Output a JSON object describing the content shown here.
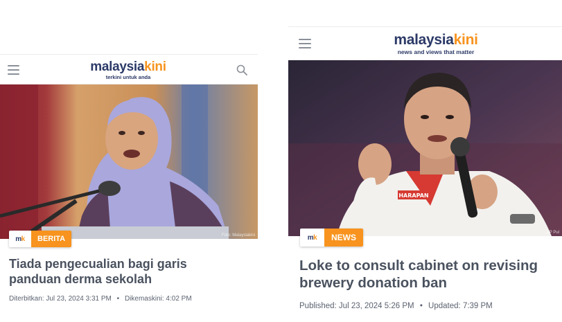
{
  "left_card": {
    "logo_part1": "malaysia",
    "logo_part2": "kini",
    "tagline": "terkini untuk anda",
    "photo_credit": "Foto: Malaysiakini",
    "badge_mark_1": "m",
    "badge_mark_2": "k",
    "category": "BERITA",
    "headline": "Tiada pengecualian bagi garis panduan derma sekolah",
    "published_label": "Diterbitkan:",
    "published_value": "Jul 23, 2024 3:31 PM",
    "separator": "•",
    "updated_label": "Dikemaskini:",
    "updated_value": "4:02 PM"
  },
  "right_card": {
    "logo_part1": "malaysia",
    "logo_part2": "kini",
    "tagline": "news and views that matter",
    "photo_credit": "AP Pul",
    "shirt_text": "HARAPAN",
    "badge_mark_1": "m",
    "badge_mark_2": "k",
    "category": "NEWS",
    "headline": "Loke to consult cabinet on revising brewery donation ban",
    "published_label": "Published:",
    "published_value": "Jul 23, 2024 5:26 PM",
    "separator": "•",
    "updated_label": "Updated:",
    "updated_value": "7:39 PM"
  },
  "colors": {
    "brand_navy": "#2c3a67",
    "brand_orange": "#f7931e",
    "headline_text": "#4a525f",
    "meta_text": "#5b6270"
  },
  "icons": [
    "menu-icon",
    "search-icon"
  ]
}
